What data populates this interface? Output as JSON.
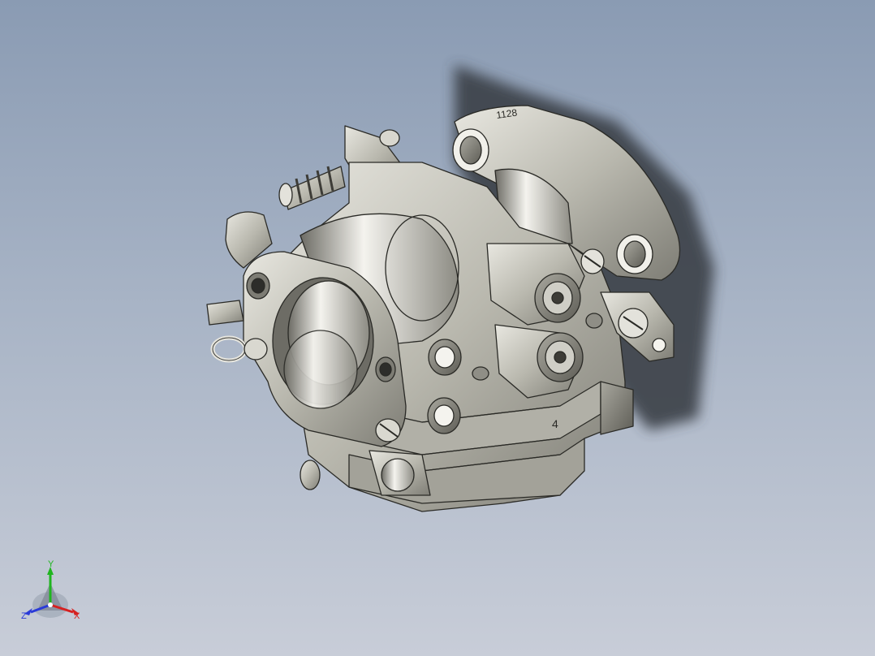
{
  "viewport": {
    "background_top": "#8a9bb3",
    "background_bottom": "#c8cdd8"
  },
  "model": {
    "part_marking": "1128",
    "bowl_marking": "4",
    "body_color": "#c9c8bf",
    "shadow_color": "#3b3f47"
  },
  "triad": {
    "x_label": "X",
    "y_label": "Y",
    "z_label": "Z",
    "x_color": "#d62020",
    "y_color": "#1fb51f",
    "z_color": "#2a3ad8"
  }
}
